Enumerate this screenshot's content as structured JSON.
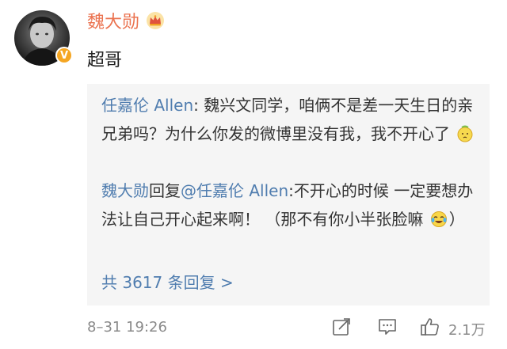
{
  "comment": {
    "username": "魏大勋",
    "text": "超哥",
    "badge": "V"
  },
  "replies": [
    {
      "author": "任嘉伦 Allen",
      "separator": ": ",
      "text": "魏兴文同学，咱俩不是差一天生日的亲兄弟吗？为什么你发的微博里没有我，我不开心了",
      "emoji": "pouting-face-icon"
    },
    {
      "author": "魏大勋",
      "action": "回复",
      "mention": "@任嘉伦 Allen",
      "text": ":不开心的时候 一定要想办法让自己开心起来啊！ （那不有你小半张脸嘛",
      "emoji": "crying-laughing-face-icon",
      "tail": "）"
    }
  ],
  "more_replies": "共 3617 条回复 >",
  "footer": {
    "timestamp": "8–31 19:26",
    "like_count": "2.1万"
  },
  "colors": {
    "username": "#eb7350",
    "link": "#507daf",
    "reply_bg": "#f5f5f5",
    "meta": "#8a8a8a"
  }
}
